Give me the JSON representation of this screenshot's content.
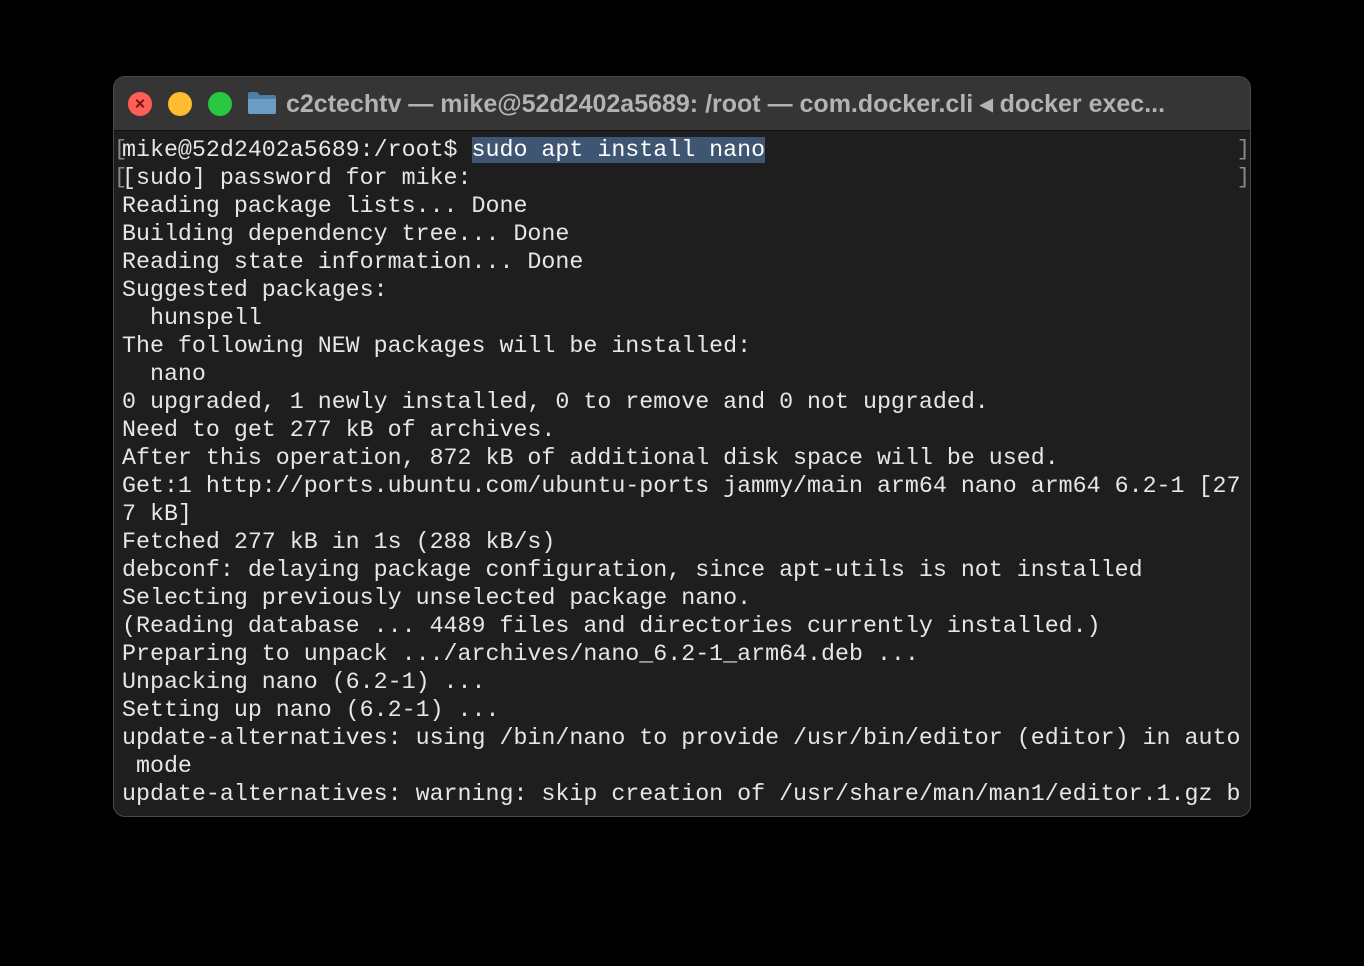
{
  "window": {
    "title": "c2ctechtv — mike@52d2402a5689: /root — com.docker.cli ◂ docker exec..."
  },
  "terminal": {
    "prompt": "mike@52d2402a5689:/root$ ",
    "command": "sudo apt install nano",
    "bracket_open": "[",
    "bracket_close": "]",
    "lines": [
      "[sudo] password for mike:",
      "Reading package lists... Done",
      "Building dependency tree... Done",
      "Reading state information... Done",
      "Suggested packages:",
      "  hunspell",
      "The following NEW packages will be installed:",
      "  nano",
      "0 upgraded, 1 newly installed, 0 to remove and 0 not upgraded.",
      "Need to get 277 kB of archives.",
      "After this operation, 872 kB of additional disk space will be used.",
      "Get:1 http://ports.ubuntu.com/ubuntu-ports jammy/main arm64 nano arm64 6.2-1 [27",
      "7 kB]",
      "Fetched 277 kB in 1s (288 kB/s)",
      "debconf: delaying package configuration, since apt-utils is not installed",
      "Selecting previously unselected package nano.",
      "(Reading database ... 4489 files and directories currently installed.)",
      "Preparing to unpack .../archives/nano_6.2-1_arm64.deb ...",
      "Unpacking nano (6.2-1) ...",
      "Setting up nano (6.2-1) ...",
      "update-alternatives: using /bin/nano to provide /usr/bin/editor (editor) in auto",
      " mode",
      "update-alternatives: warning: skip creation of /usr/share/man/man1/editor.1.gz b"
    ]
  },
  "colors": {
    "background": "#000000",
    "window_bg": "#1e1e1e",
    "titlebar_bg": "#353535",
    "text": "#e6e6e6",
    "selection": "#3e5672",
    "close": "#ff5f57",
    "minimize": "#febc2e",
    "maximize": "#28c840",
    "folder": "#5f8fb3"
  },
  "icons": {
    "window_folder": "folder-icon"
  }
}
